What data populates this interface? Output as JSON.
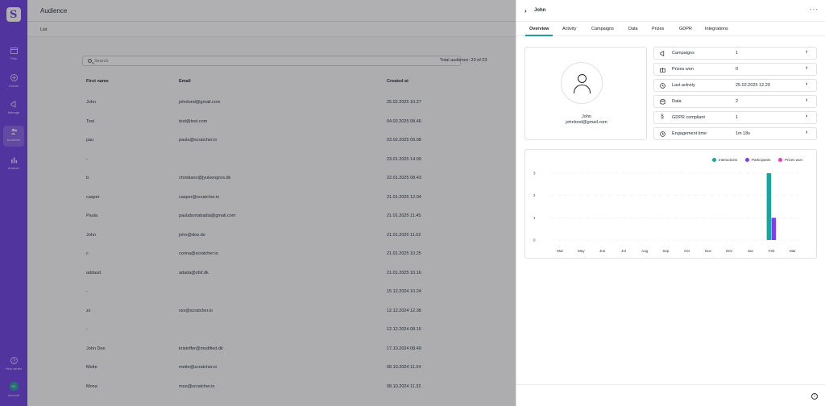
{
  "nav": {
    "items": [
      {
        "label": "Plan"
      },
      {
        "label": "Create"
      },
      {
        "label": "Manage"
      },
      {
        "label": "Audience"
      },
      {
        "label": "Analyze"
      }
    ],
    "help_label": "Help center",
    "account_label": "Account",
    "account_initials": "SE"
  },
  "main": {
    "title": "Audience",
    "subnav_label": "List",
    "search_placeholder": "Search",
    "total_label": "Total audience: 23 of 23",
    "columns": [
      "First name",
      "Email",
      "Created at"
    ],
    "rows": [
      {
        "first": "John",
        "email": "johnlond@gmail.com",
        "created": "25.02.2025 10.27"
      },
      {
        "first": "Test",
        "email": "test@test.com",
        "created": "04.02.2025 08.46"
      },
      {
        "first": "pau",
        "email": "paula@scratcher.io",
        "created": "03.02.2025 09.08"
      },
      {
        "first": "-",
        "email": "",
        "created": "23.01.2025 14.00"
      },
      {
        "first": "b",
        "email": "christiano@jyulsengros.dk",
        "created": "22.01.2025 08.43"
      },
      {
        "first": "casper",
        "email": "casper@scratcher.io",
        "created": "21.01.2025 12.04"
      },
      {
        "first": "Paula",
        "email": "paulaborrabadia@gmail.com",
        "created": "21.01.2025 11.45"
      },
      {
        "first": "John",
        "email": "john@doe.de",
        "created": "21.01.2025 11.02"
      },
      {
        "first": "c",
        "email": "corina@scratcher.io",
        "created": "21.01.2025 10.25"
      },
      {
        "first": "addasd",
        "email": "adada@sfsf.dk",
        "created": "21.01.2025 10.16"
      },
      {
        "first": "-",
        "email": "",
        "created": "15.12.2024 10.24"
      },
      {
        "first": "zx",
        "email": "xxx@scratcher.io",
        "created": "12.12.2024 12.38"
      },
      {
        "first": "-",
        "email": "",
        "created": "12.12.2024 08.15"
      },
      {
        "first": "John Doe",
        "email": "kristoffer@modified.dk",
        "created": "17.10.2024 08.49"
      },
      {
        "first": "Mette",
        "email": "mette@scratcher.io",
        "created": "08.10.2024 11.34"
      },
      {
        "first": "Mona",
        "email": "moo@scratcher.io",
        "created": "08.10.2024 11.32"
      }
    ]
  },
  "drawer": {
    "name": "John",
    "more_label": "···",
    "tabs": [
      "Overview",
      "Activity",
      "Campaigns",
      "Data",
      "Prizes",
      "GDPR",
      "Integrations"
    ],
    "profile": {
      "name": "John",
      "email": "johnlond@gmail.com"
    },
    "stats": [
      {
        "label": "Campaigns",
        "value": "1",
        "icon": "megaphone-icon"
      },
      {
        "label": "Prizes won",
        "value": "0",
        "icon": "gift-icon"
      },
      {
        "label": "Last activity",
        "value": "25.02.2025 12.29",
        "icon": "history-icon"
      },
      {
        "label": "Data",
        "value": "2",
        "icon": "database-icon"
      },
      {
        "label": "GDPR compliant",
        "value": "1",
        "icon": "section-icon"
      },
      {
        "label": "Engagement time",
        "value": "1m 18s",
        "icon": "clock-icon"
      }
    ]
  },
  "colors": {
    "accent": "#1f9e9a",
    "nav": "#6c3ee0",
    "interactions": "#1aa59c",
    "participants": "#7b3ff2",
    "prizes": "#e040c0"
  },
  "chart_data": {
    "type": "bar",
    "categories": [
      "Mar",
      "May",
      "Jun",
      "Jul",
      "Aug",
      "Sep",
      "Oct",
      "Nov",
      "Dec",
      "Jan",
      "Feb",
      "Mar"
    ],
    "series": [
      {
        "name": "Interactions",
        "values": [
          0,
          0,
          0,
          0,
          0,
          0,
          0,
          0,
          0,
          0,
          3,
          0
        ]
      },
      {
        "name": "Participants",
        "values": [
          0,
          0,
          0,
          0,
          0,
          0,
          0,
          0,
          0,
          0,
          1,
          0
        ]
      },
      {
        "name": "Prizes won",
        "values": [
          0,
          0,
          0,
          0,
          0,
          0,
          0,
          0,
          0,
          0,
          0,
          0
        ]
      }
    ],
    "yticks": [
      "0",
      "1",
      "2",
      "3"
    ],
    "ylim": [
      0,
      3
    ],
    "legend_position": "top-right",
    "grid": true
  }
}
